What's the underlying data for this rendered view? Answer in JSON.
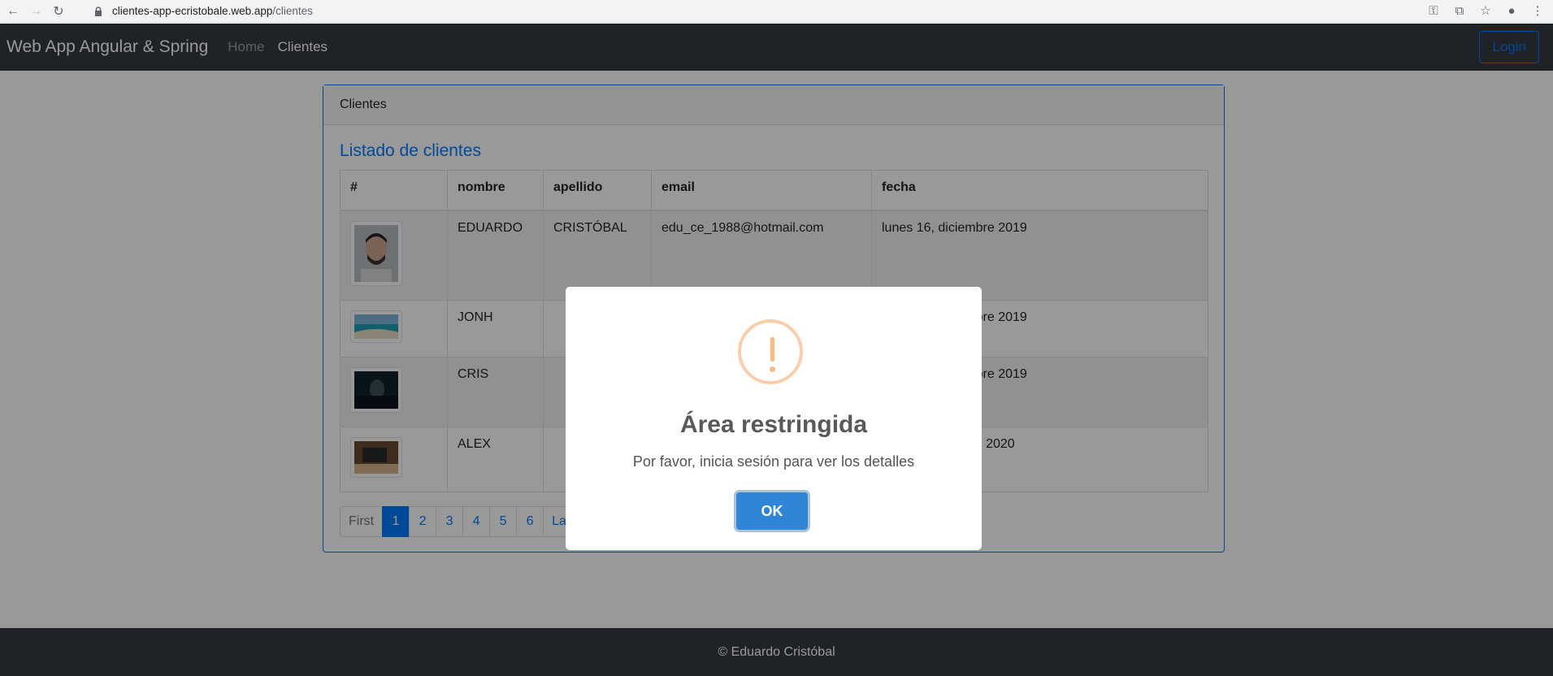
{
  "browser": {
    "url_host": "clientes-app-ecristobale.web.app",
    "url_path": "/clientes"
  },
  "navbar": {
    "brand": "Web App Angular & Spring",
    "links": [
      {
        "label": "Home"
      },
      {
        "label": "Clientes"
      }
    ],
    "login_label": "Login"
  },
  "card": {
    "header": "Clientes",
    "title": "Listado de clientes",
    "columns": [
      "#",
      "nombre",
      "apellido",
      "email",
      "fecha"
    ],
    "rows": [
      {
        "nombre": "EDUARDO",
        "apellido": "CRISTÓBAL",
        "email": "edu_ce_1988@hotmail.com",
        "fecha": "lunes 16, diciembre 2019"
      },
      {
        "nombre": "JONH",
        "apellido": "",
        "email": "",
        "fecha": "lunes 16, diciembre 2019"
      },
      {
        "nombre": "CRIS",
        "apellido": "",
        "email": "",
        "fecha": "lunes 16, diciembre 2019"
      },
      {
        "nombre": "ALEX",
        "apellido": "",
        "email": "",
        "fecha": "viernes 31, enero 2020"
      }
    ],
    "pagination": [
      "First",
      "1",
      "2",
      "3",
      "4",
      "5",
      "6",
      "Last"
    ]
  },
  "footer": {
    "text": "© Eduardo Cristóbal"
  },
  "modal": {
    "title": "Área restringida",
    "text": "Por favor, inicia sesión para ver los detalles",
    "ok_label": "OK"
  },
  "colors": {
    "navbar_bg": "#343a40",
    "primary": "#007bff",
    "modal_button": "#3085d6",
    "warning_icon": "#f8bb86"
  }
}
